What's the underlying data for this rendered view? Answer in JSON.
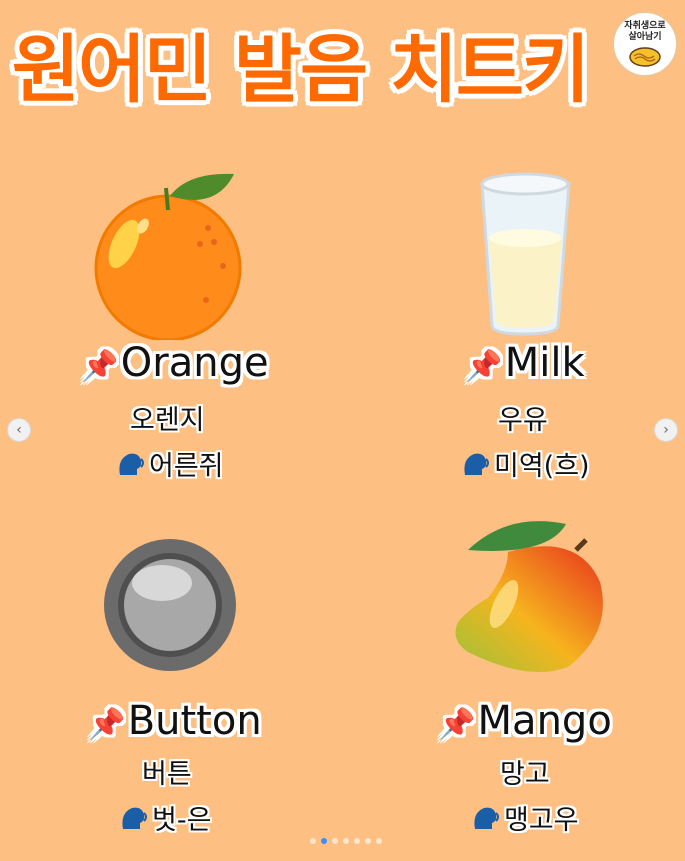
{
  "header": {
    "title": "원어민 발음 치트키",
    "logo_text_line1": "자취생으로",
    "logo_text_line2": "살아남기"
  },
  "items": [
    {
      "icon": "orange-illustration",
      "word": "Orange",
      "meaning": "오렌지",
      "pronunciation": "어른쥐"
    },
    {
      "icon": "milk-glass-illustration",
      "word": "Milk",
      "meaning": "우유",
      "pronunciation": "미역(흐)"
    },
    {
      "icon": "button-illustration",
      "word": "Button",
      "meaning": "버튼",
      "pronunciation": "벗-은"
    },
    {
      "icon": "mango-illustration",
      "word": "Mango",
      "meaning": "망고",
      "pronunciation": "맹고우"
    }
  ],
  "carousel": {
    "dot_count": 7,
    "active_index": 1
  },
  "icons": {
    "pin": "pushpin-icon",
    "speaker": "speaking-head-icon",
    "prev": "chevron-left-icon",
    "next": "chevron-right-icon"
  },
  "colors": {
    "background": "#fdbf82",
    "title": "#ff6a00"
  }
}
